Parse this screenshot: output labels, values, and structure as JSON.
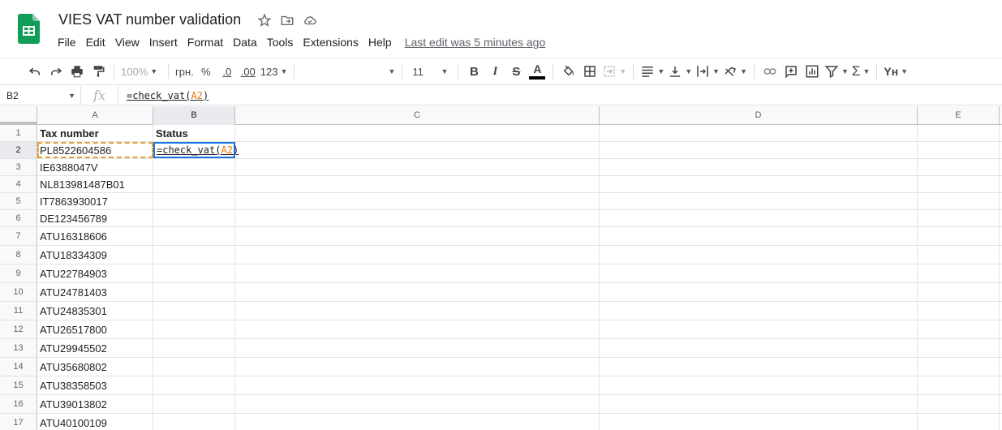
{
  "app": {
    "doc_title": "VIES VAT number validation",
    "last_edit": "Last edit was 5 minutes ago"
  },
  "menu": {
    "items": [
      "File",
      "Edit",
      "View",
      "Insert",
      "Format",
      "Data",
      "Tools",
      "Extensions",
      "Help"
    ]
  },
  "toolbar": {
    "zoom": "100%",
    "currency": "грн.",
    "percent": "%",
    "decrease_decimal": ".0",
    "increase_decimal": ".00",
    "more_formats": "123",
    "font_size": "11",
    "bold": "B",
    "italic": "I",
    "strike": "S",
    "text_color": "A",
    "sum": "Σ",
    "input_tools": "Yн"
  },
  "formula_bar": {
    "name_box": "B2",
    "fx_label": "fx",
    "formula_prefix": "=check_vat(",
    "formula_ref": "A2",
    "formula_suffix": ")"
  },
  "grid": {
    "columns": [
      "A",
      "B",
      "C",
      "D",
      "E"
    ],
    "rows": [
      {
        "num": "1",
        "a": "Tax number",
        "b": "Status"
      },
      {
        "num": "2",
        "a": "PL8522604586",
        "b_prefix": "=check_vat(",
        "b_ref": "A2",
        "b_suffix": ")"
      },
      {
        "num": "3",
        "a": "IE6388047V"
      },
      {
        "num": "4",
        "a": "NL813981487B01"
      },
      {
        "num": "5",
        "a": "IT7863930017"
      },
      {
        "num": "6",
        "a": "DE123456789"
      },
      {
        "num": "7",
        "a": "ATU16318606"
      },
      {
        "num": "8",
        "a": "ATU18334309"
      },
      {
        "num": "9",
        "a": "ATU22784903"
      },
      {
        "num": "10",
        "a": "ATU24781403"
      },
      {
        "num": "11",
        "a": "ATU24835301"
      },
      {
        "num": "12",
        "a": "ATU26517800"
      },
      {
        "num": "13",
        "a": "ATU29945502"
      },
      {
        "num": "14",
        "a": "ATU35680802"
      },
      {
        "num": "15",
        "a": "ATU38358503"
      },
      {
        "num": "16",
        "a": "ATU39013802"
      },
      {
        "num": "17",
        "a": "ATU40100109"
      }
    ]
  },
  "colors": {
    "sheets_green": "#0f9d58",
    "selection_blue": "#1a73e8",
    "copy_orange": "#e3a033",
    "ref_orange": "#e37400"
  }
}
